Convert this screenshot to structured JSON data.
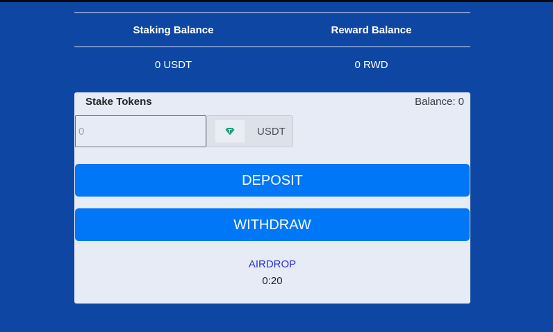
{
  "balances": {
    "headers": [
      "Staking Balance",
      "Reward Balance"
    ],
    "values": [
      "0 USDT",
      "0 RWD"
    ]
  },
  "stake": {
    "title": "Stake Tokens",
    "balance_label": "Balance: 0",
    "input_placeholder": "0",
    "token_icon": "diamond-icon",
    "token_symbol": "USDT",
    "deposit_label": "DEPOSIT",
    "withdraw_label": "WITHDRAW",
    "airdrop_label": "AIRDROP",
    "airdrop_timer": "0:20"
  },
  "colors": {
    "background": "#0e46a3",
    "card": "#e6ebf5",
    "button": "#0077f7",
    "link": "#2b2ed8",
    "token_icon": "#1ba27a"
  }
}
